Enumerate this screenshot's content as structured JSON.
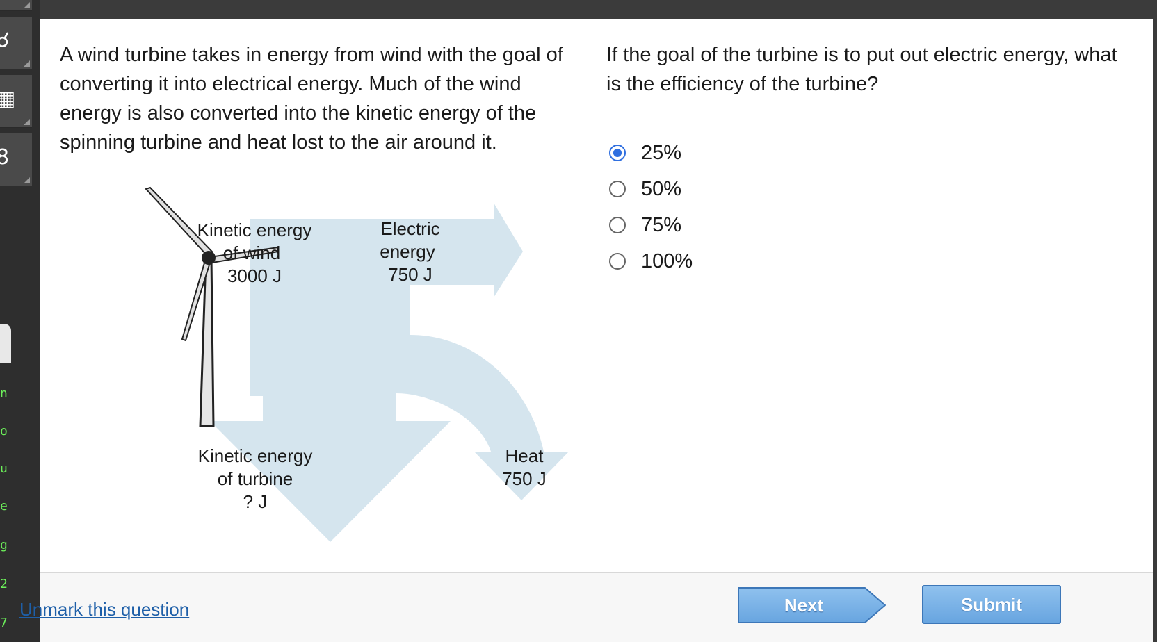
{
  "passage": {
    "text": "A wind turbine takes in energy from wind with the goal of converting it into electrical energy. Much of the wind energy is also converted into the kinetic energy of the spinning turbine and heat lost to the air around it."
  },
  "question": {
    "text": "If the goal of the turbine is to put out electric energy, what is the efficiency of the turbine?"
  },
  "options": [
    {
      "label": "25%",
      "selected": true
    },
    {
      "label": "50%",
      "selected": false
    },
    {
      "label": "75%",
      "selected": false
    },
    {
      "label": "100%",
      "selected": false
    }
  ],
  "diagram": {
    "input": {
      "line1": "Kinetic energy",
      "line2": "of wind",
      "value": "3000 J"
    },
    "electric": {
      "line1": "Electric",
      "line2": "energy",
      "value": "750 J"
    },
    "turbine": {
      "line1": "Kinetic energy",
      "line2": "of turbine",
      "value": "? J"
    },
    "heat": {
      "line1": "Heat",
      "value": "750 J"
    },
    "arrow_color": "#d5e5ee"
  },
  "footer": {
    "unmark_label": "Unmark this question",
    "next_label": "Next",
    "submit_label": "Submit"
  },
  "rail": {
    "letters": [
      "n",
      "o",
      "u",
      "e",
      "g",
      "2",
      "7"
    ],
    "letter_color": "#6cf05a",
    "tools": [
      "headphones-icon",
      "calculator-icon",
      "reference-icon"
    ]
  },
  "colors": {
    "selected_radio": "#2f6fe0",
    "link": "#1e5fa8",
    "button": "#7fb6ea"
  }
}
